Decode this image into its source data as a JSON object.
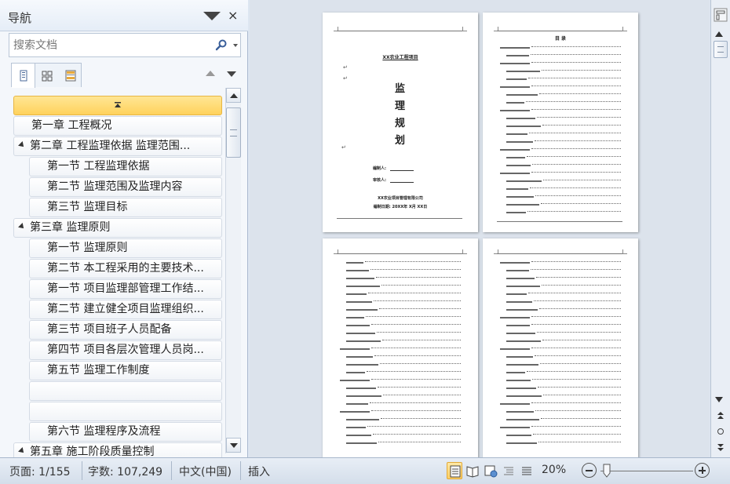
{
  "nav": {
    "title": "导航",
    "close": "×",
    "search_placeholder": "搜索文档",
    "tree": [
      {
        "label": "第一章 工程概况",
        "level": 1,
        "expanded": false
      },
      {
        "label": "第二章  工程监理依据   监理范围...",
        "level": 1,
        "expanded": true
      },
      {
        "label": "第一节  工程监理依据",
        "level": 2
      },
      {
        "label": "第二节  监理范围及监理内容",
        "level": 2
      },
      {
        "label": "第三节  监理目标",
        "level": 2
      },
      {
        "label": "第三章 监理原则",
        "level": 1,
        "expanded": true
      },
      {
        "label": "第一节  监理原则",
        "level": 2
      },
      {
        "label": "第二节 本工程采用的主要技术...",
        "level": 2
      },
      {
        "label": "第一节 项目监理部管理工作结...",
        "level": 2
      },
      {
        "label": "第二节  建立健全项目监理组织...",
        "level": 2
      },
      {
        "label": "第三节 项目班子人员配备",
        "level": 2
      },
      {
        "label": "第四节 项目各层次管理人员岗...",
        "level": 2
      },
      {
        "label": "第五节 监理工作制度",
        "level": 2
      },
      {
        "label": "",
        "level": 2
      },
      {
        "label": "",
        "level": 2
      },
      {
        "label": "第六节 监理程序及流程",
        "level": 2
      },
      {
        "label": "第五章  施工阶段质量控制",
        "level": 1,
        "expanded": true
      }
    ]
  },
  "cover": {
    "project": "XX农业工程项目",
    "ret": "↵",
    "chars": [
      "监",
      "理",
      "规",
      "划"
    ],
    "field1": "编制人:",
    "field2": "审核人:",
    "company": "XX农业项目管理有限公司",
    "date": "编制日期:  20XX年  X月 XX日"
  },
  "toc": {
    "title": "目  录"
  },
  "status": {
    "page": "页面: 1/155",
    "words": "字数: 107,249",
    "lang": "中文(中国)",
    "mode": "插入",
    "zoom": "20%"
  }
}
